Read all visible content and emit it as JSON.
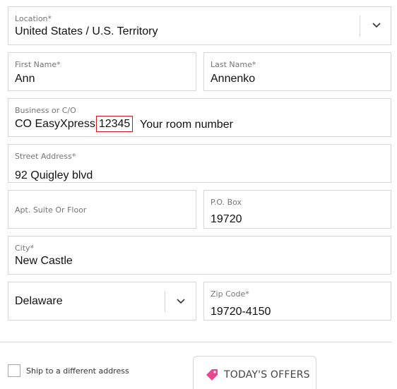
{
  "form": {
    "location": {
      "label": "Location*",
      "value": "United States / U.S. Territory"
    },
    "first_name": {
      "label": "First Name*",
      "value": "Ann"
    },
    "last_name": {
      "label": "Last Name*",
      "value": "Annenko"
    },
    "business": {
      "label": "Business or C/O",
      "value_prefix": "CO EasyXpress",
      "value_highlight": "12345",
      "annotation": "Your room number"
    },
    "street": {
      "label": "Street Address*",
      "value": "92 Quigley blvd"
    },
    "apt": {
      "label": "Apt. Suite Or Floor",
      "value": ""
    },
    "po_box": {
      "label": "P.O. Box",
      "value": "19720"
    },
    "city": {
      "label": "City*",
      "value": "New Castle"
    },
    "state": {
      "value": "Delaware"
    },
    "zip": {
      "label": "Zip Code*",
      "value": "19720-4150"
    }
  },
  "ship_different": {
    "label": "Ship to a different address",
    "checked": false
  },
  "offers_button": {
    "label": "TODAY'S OFFERS",
    "icon": "tag-icon"
  },
  "colors": {
    "highlight_border": "#d0191b",
    "offers_icon": "#e8488f"
  }
}
